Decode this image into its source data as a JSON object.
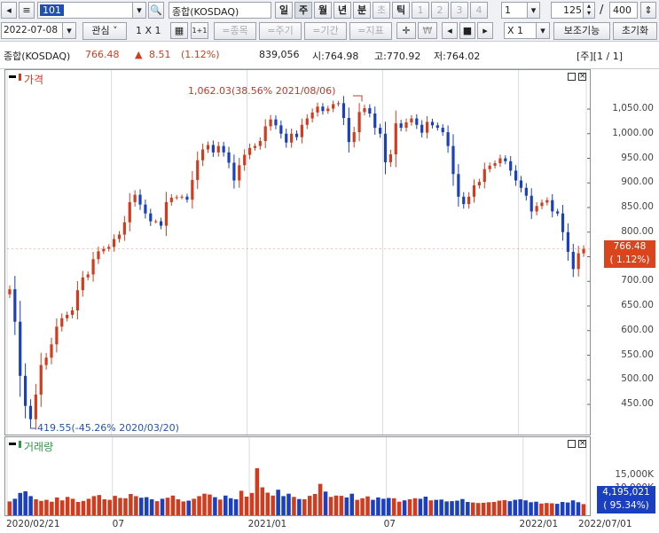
{
  "toolbar": {
    "code_value": "101",
    "index_name": "종합(KOSDAQ)",
    "periods": [
      "일",
      "주",
      "월",
      "년",
      "분",
      "초",
      "틱",
      "1",
      "2",
      "3",
      "4"
    ],
    "active_period": "주",
    "period_number": "1",
    "view_count": "125",
    "total_count": "400",
    "slash": "/",
    "date_value": "2022-07-08",
    "watch_label": "관심",
    "layout_label": "1 X 1",
    "pill_stock": "=종목",
    "pill_period": "=주기",
    "pill_range": "=기간",
    "pill_indicator": "=지표",
    "multiplier": "X 1",
    "aux_label": "보조기능",
    "reset_label": "초기화",
    "won_symbol": "₩"
  },
  "info": {
    "name": "종합(KOSDAQ)",
    "price": "766.48",
    "change_arrow": "▲",
    "change": "8.51",
    "change_pct": "(1.12%)",
    "volume": "839,056",
    "open": "시:764.98",
    "high": "고:770.92",
    "low": "저:764.02",
    "page_indicator": "[주][1 / 1]"
  },
  "price_pane": {
    "title": "가격",
    "high_annotation": "1,062.03(38.56% 2021/08/06)",
    "low_annotation": "419.55(-45.26% 2020/03/20)",
    "current_label": "766.48",
    "current_pct": "( 1.12%)",
    "y_ticks": [
      "1,050.00",
      "1,000.00",
      "950.00",
      "900.00",
      "850.00",
      "800.00",
      "750.00",
      "700.00",
      "650.00",
      "600.00",
      "550.00",
      "500.00",
      "450.00"
    ],
    "y_tick_values": [
      1050,
      1000,
      950,
      900,
      850,
      800,
      750,
      700,
      650,
      600,
      550,
      500,
      450
    ]
  },
  "volume_pane": {
    "title": "거래량",
    "y_ticks": [
      "15,000K",
      "10,000K"
    ],
    "y_tick_values": [
      15000,
      10000
    ],
    "current_label": "4,195,021",
    "current_pct": "( 95.34%)"
  },
  "x_axis": {
    "labels": [
      "2020/02/21",
      "07",
      "2021/01",
      "07",
      "2022/01",
      "2022/07/01"
    ]
  },
  "colors": {
    "up": "#d23c1e",
    "down": "#1a3fbf",
    "accent": "#d9461e"
  },
  "chart_data": {
    "type": "candlestick",
    "period": "weekly",
    "x_range": [
      "2020/02/21",
      "2022/07/08"
    ],
    "ylim": [
      400,
      1100
    ],
    "series": [
      {
        "name": "가격",
        "values": [
          684,
          618,
          508,
          447,
          420,
          470,
          530,
          545,
          572,
          608,
          625,
          632,
          641,
          682,
          708,
          714,
          745,
          761,
          766,
          770,
          786,
          795,
          820,
          861,
          876,
          856,
          838,
          822,
          822,
          813,
          861,
          870,
          871,
          872,
          866,
          906,
          946,
          968,
          977,
          962,
          975,
          962,
          941,
          905,
          936,
          957,
          971,
          975,
          985,
          1015,
          1029,
          1017,
          1000,
          982,
          1000,
          993,
          1018,
          1031,
          1043,
          1055,
          1046,
          1051,
          1060,
          1062,
          1032,
          983,
          1003,
          1044,
          1052,
          1041,
          1012,
          1000,
          942,
          958,
          1021,
          1012,
          1023,
          1031,
          1018,
          1002,
          1024,
          1017,
          1012,
          1003,
          975,
          918,
          872,
          857,
          872,
          895,
          902,
          928,
          935,
          940,
          950,
          944,
          925,
          905,
          890,
          874,
          842,
          853,
          860,
          865,
          842,
          838,
          800,
          760,
          725,
          757,
          766
        ]
      },
      {
        "name": "거래량",
        "values": [
          5200,
          6200,
          8400,
          9000,
          7200,
          6000,
          5400,
          5800,
          5100,
          6700,
          5600,
          6900,
          6200,
          5000,
          5400,
          6200,
          7200,
          7600,
          6000,
          5800,
          7300,
          6500,
          6400,
          8000,
          7200,
          6600,
          6800,
          6000,
          5300,
          6200,
          6600,
          7400,
          6000,
          5200,
          5500,
          6200,
          7200,
          8100,
          7800,
          6800,
          5900,
          7400,
          6400,
          6000,
          9200,
          7000,
          8400,
          17700,
          10500,
          8500,
          7400,
          9600,
          7200,
          8100,
          6900,
          6100,
          6000,
          7300,
          8000,
          11800,
          8900,
          6900,
          7400,
          7300,
          6700,
          8100,
          5800,
          6400,
          7100,
          5800,
          6700,
          6200,
          6500,
          6400,
          5100,
          5600,
          6000,
          6400,
          6200,
          7000,
          5600,
          5800,
          5900,
          5200,
          5300,
          5500,
          6100,
          5000,
          4800,
          4600,
          4700,
          4900,
          5000,
          5500,
          5700,
          5300,
          5800,
          6000,
          5600,
          4900,
          5100,
          4400,
          4600,
          4500,
          4300,
          5000,
          4800,
          5600,
          4900,
          4200
        ]
      }
    ],
    "highest": {
      "value": 1062.03,
      "pct": 38.56,
      "date": "2021/08/06"
    },
    "lowest": {
      "value": 419.55,
      "pct": -45.26,
      "date": "2020/03/20"
    },
    "last": {
      "value": 766.48,
      "change": 8.51,
      "pct": 1.12,
      "volume": 4195021
    }
  }
}
